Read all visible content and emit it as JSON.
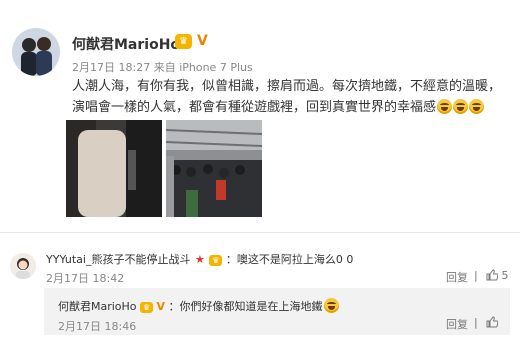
{
  "post": {
    "username": "何猷君MarioHo",
    "vip_label": "V",
    "timestamp": "2月17日 18:27",
    "source": "来自 iPhone 7 Plus",
    "text": "人潮人海，有你有我，似曾相識，擦肩而過。每次擠地鐵，不經意的溫暖，演唱會一樣的人氣，都會有種從遊戲裡，回到真實世界的幸福感",
    "emoji_count": 3
  },
  "comment": {
    "username": "YYYutai_熊孩子不能停止战斗",
    "text": "：噢这不是阿拉上海么0 0",
    "timestamp": "2月17日 18:42",
    "reply_label": "回复",
    "like_count": "5"
  },
  "reply": {
    "username": "何猷君MarioHo",
    "text": "：你們好像都知道是在上海地鐵",
    "timestamp": "2月17日 18:46",
    "reply_label": "回复"
  },
  "colors": {
    "vip_gold": "#f5b400",
    "verified_orange": "#f08300",
    "star_red": "#e0332e",
    "reply_bg": "#f2f2f2"
  }
}
